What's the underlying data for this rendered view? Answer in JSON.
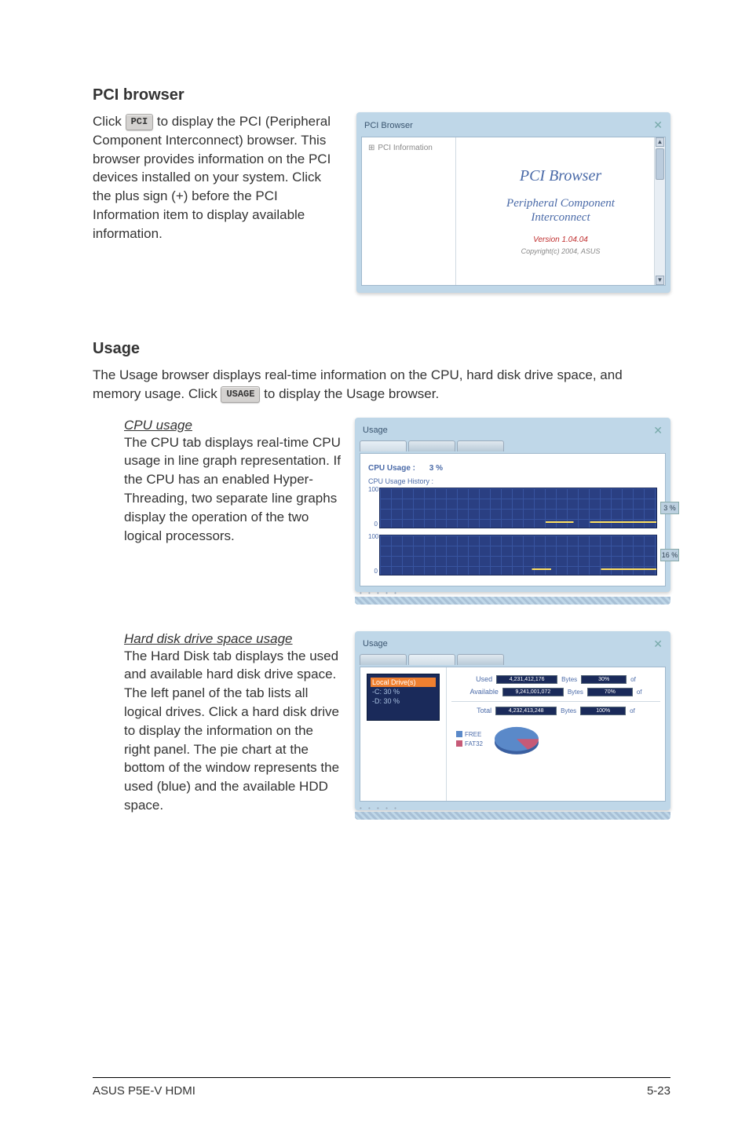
{
  "sections": {
    "pci": {
      "title": "PCI browser",
      "para_before": "Click ",
      "button_label": "PCI",
      "para_after": " to display the PCI (Peripheral Component Interconnect) browser. This browser provides information on the PCI devices installed on your system. Click the plus sign (+) before the PCI Information item to display available information."
    },
    "usage": {
      "title": "Usage",
      "intro_before": "The Usage browser displays real-time information on the CPU, hard disk drive space, and memory usage. Click ",
      "button_label": "USAGE",
      "intro_after": " to display the Usage browser.",
      "cpu": {
        "subtitle": "CPU usage",
        "body": "The CPU tab displays real-time CPU usage in line graph representation. If the CPU has an enabled Hyper-Threading, two separate line graphs display the operation of the two logical processors."
      },
      "hdd": {
        "subtitle": "Hard disk drive space usage",
        "body": "The Hard Disk tab displays the used and available hard disk drive space. The left panel of the tab lists all logical drives. Click a hard disk drive to display the information on the right panel. The pie chart at the bottom of the window represents the used (blue) and the available HDD space."
      }
    }
  },
  "pci_window": {
    "titlebar": "PCI Browser",
    "tree_root": "PCI Information",
    "heading": "PCI Browser",
    "subline1": "Peripheral Component",
    "subline2": "Interconnect",
    "version": "Version 1.04.04",
    "copyright": "Copyright(c) 2004, ASUS"
  },
  "cpu_window": {
    "titlebar": "Usage",
    "label": "CPU Usage :",
    "label_val": "3 %",
    "history": "CPU Usage History :",
    "tick_hi": "100",
    "tick_lo": "0",
    "pct1": "3 %",
    "pct2": "16 %"
  },
  "hdd_window": {
    "titlebar": "Usage",
    "drives_header": "Local Drive(s)",
    "drive_c": "-C: 30 %",
    "drive_d": "-D: 30 %",
    "used_label": "Used",
    "used_val": "4,231,412,176",
    "used_unit": "Bytes",
    "used_pct": "30%",
    "used_pct_unit": "of",
    "avail_label": "Available",
    "avail_val": "9,241,001,072",
    "avail_unit": "Bytes",
    "avail_pct": "70%",
    "avail_pct_unit": "of",
    "total_label": "Total",
    "total_val": "4,232,413,248",
    "total_unit": "Bytes",
    "total_pct": "100%",
    "total_pct_unit": "of",
    "legend_free": "FREE",
    "format": "FAT32"
  },
  "footer": {
    "left": "ASUS P5E-V HDMI",
    "right": "5-23"
  }
}
